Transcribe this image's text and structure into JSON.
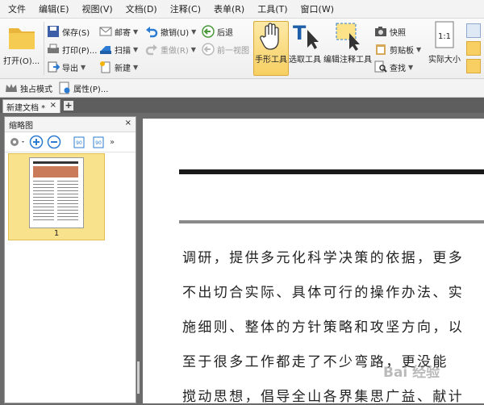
{
  "menu": [
    "文件",
    "编辑(E)",
    "视图(V)",
    "文档(D)",
    "注释(C)",
    "表单(R)",
    "工具(T)",
    "窗口(W)"
  ],
  "ribbon": {
    "open": "打开(O)...",
    "save": "保存(S)",
    "print": "打印(P)...",
    "export": "导出",
    "mail": "邮寄",
    "scan": "扫描",
    "new": "新建",
    "undo": "撤销(U)",
    "redo": "重做(R)",
    "back": "后退",
    "prev_view": "前一视图",
    "hand_tool": "手形工具",
    "select_tool": "选取工具",
    "edit_annot": "编辑注释工具",
    "snapshot": "快照",
    "clipboard": "剪贴板",
    "find": "查找",
    "actual_size": "实际大小",
    "actual_size_icon_text": "1:1"
  },
  "toolbar2": {
    "exclusive_mode": "独占模式",
    "properties": "属性(P)..."
  },
  "tabs": {
    "doc_tab": "新建文档 *",
    "close": "×",
    "new_tab": "+"
  },
  "thumb_panel": {
    "title": "缩略图",
    "close": "×",
    "page_number": "1",
    "rotate_left": "90",
    "rotate_right": "90"
  },
  "document": {
    "lines": [
      "调研，提供多元化科学决策的依据，更多",
      "不出切合实际、具体可行的操作办法、实",
      "施细则、整体的方针策略和攻坚方向，以",
      "至于很多工作都走了不少弯路，更没能",
      "搅动思想，倡导全山各界集思广益、献计"
    ],
    "watermark": "Bai 经验"
  }
}
